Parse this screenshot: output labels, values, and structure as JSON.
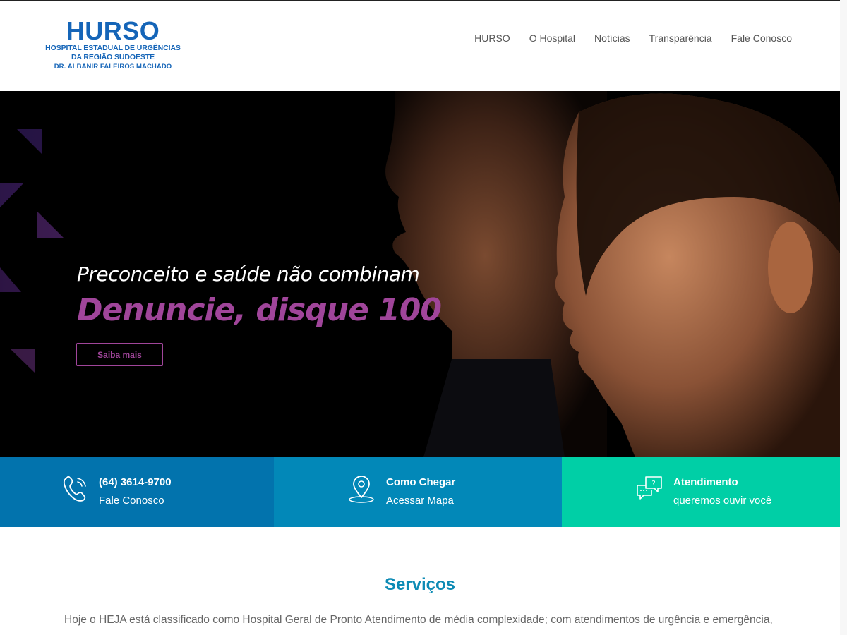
{
  "logo": {
    "name": "HURSO",
    "line1": "HOSPITAL ESTADUAL DE URGÊNCIAS",
    "line2": "DA REGIÃO SUDOESTE",
    "line3": "DR. ALBANIR FALEIROS MACHADO"
  },
  "nav": {
    "items": [
      "HURSO",
      "O Hospital",
      "Notícias",
      "Transparência",
      "Fale Conosco"
    ]
  },
  "hero": {
    "subtitle": "Preconceito e saúde não combinam",
    "title": "Denuncie, disque 100",
    "button": "Saiba mais"
  },
  "info": [
    {
      "title": "(64) 3614-9700",
      "subtitle": "Fale Conosco",
      "icon": "phone-icon"
    },
    {
      "title": "Como Chegar",
      "subtitle": "Acessar Mapa",
      "icon": "map-pin-icon"
    },
    {
      "title": "Atendimento",
      "subtitle": "queremos ouvir você",
      "icon": "chat-bubbles-icon"
    }
  ],
  "services": {
    "title": "Serviços",
    "text": "Hoje o HEJA está classificado como Hospital Geral de Pronto Atendimento de média complexidade; com atendimentos de urgência e emergência,"
  },
  "colors": {
    "brand_blue": "#1565b8",
    "accent_purple": "#a0459a",
    "info_1": "#0273ad",
    "info_2": "#0288b8",
    "info_3": "#00cfa6",
    "services_title": "#0d8bb5"
  }
}
